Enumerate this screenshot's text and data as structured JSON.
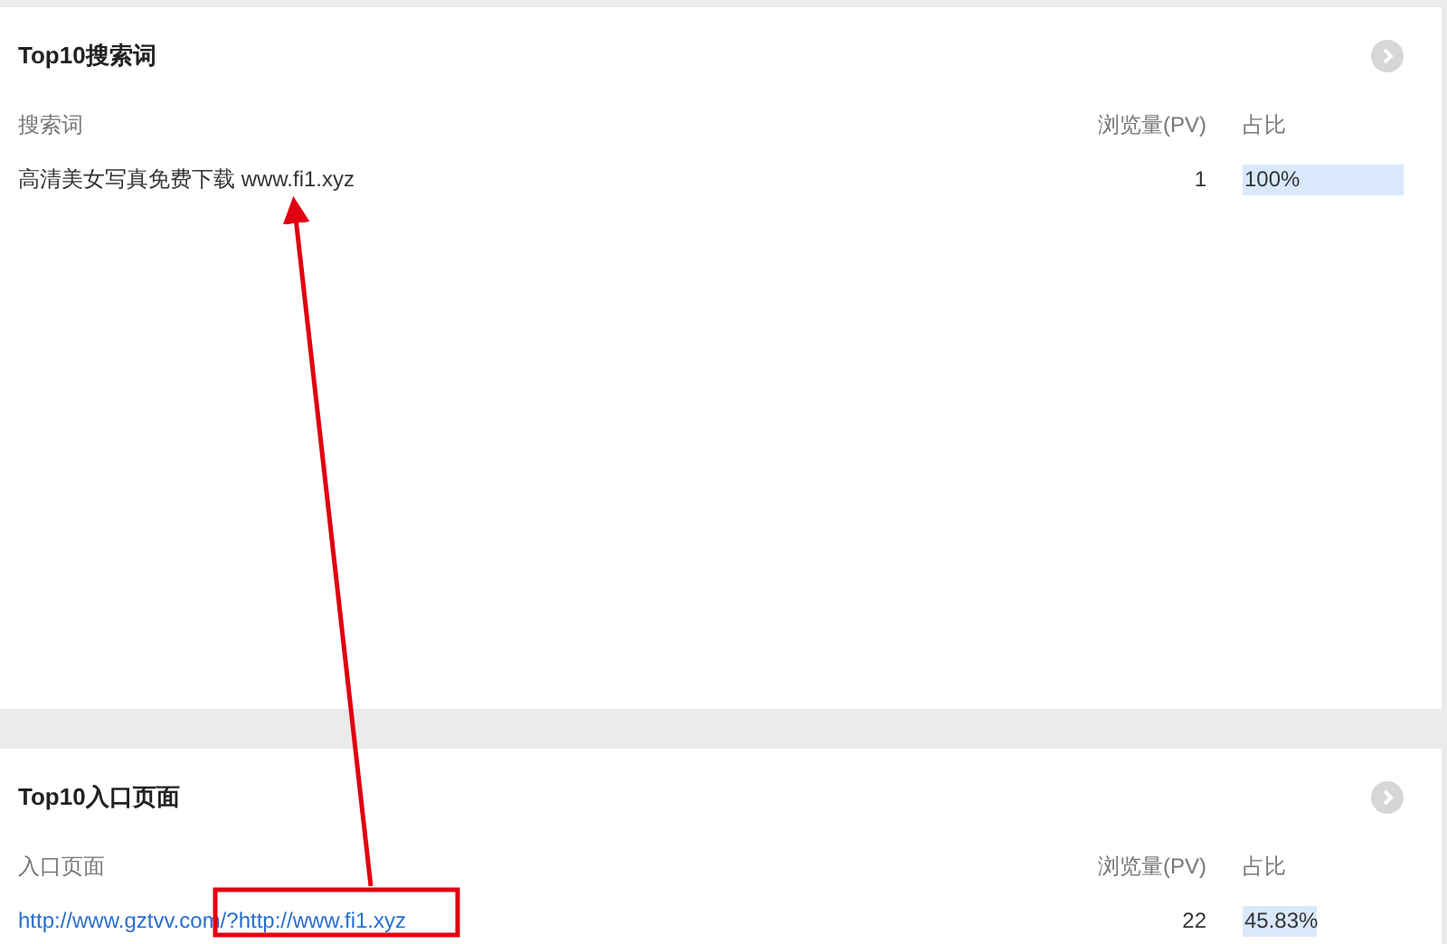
{
  "panels": [
    {
      "title": "Top10搜索词",
      "columns": [
        "搜索词",
        "浏览量(PV)",
        "占比"
      ],
      "link_rows": false,
      "rows": [
        {
          "term": "高清美女写真免费下载 www.fi1.xyz",
          "pv": "1",
          "share": "100%"
        }
      ]
    },
    {
      "title": "Top10入口页面",
      "columns": [
        "入口页面",
        "浏览量(PV)",
        "占比"
      ],
      "link_rows": true,
      "rows": [
        {
          "term": "http://www.gztvv.com/?http://www.fi1.xyz",
          "pv": "22",
          "share": "45.83%"
        }
      ]
    }
  ]
}
